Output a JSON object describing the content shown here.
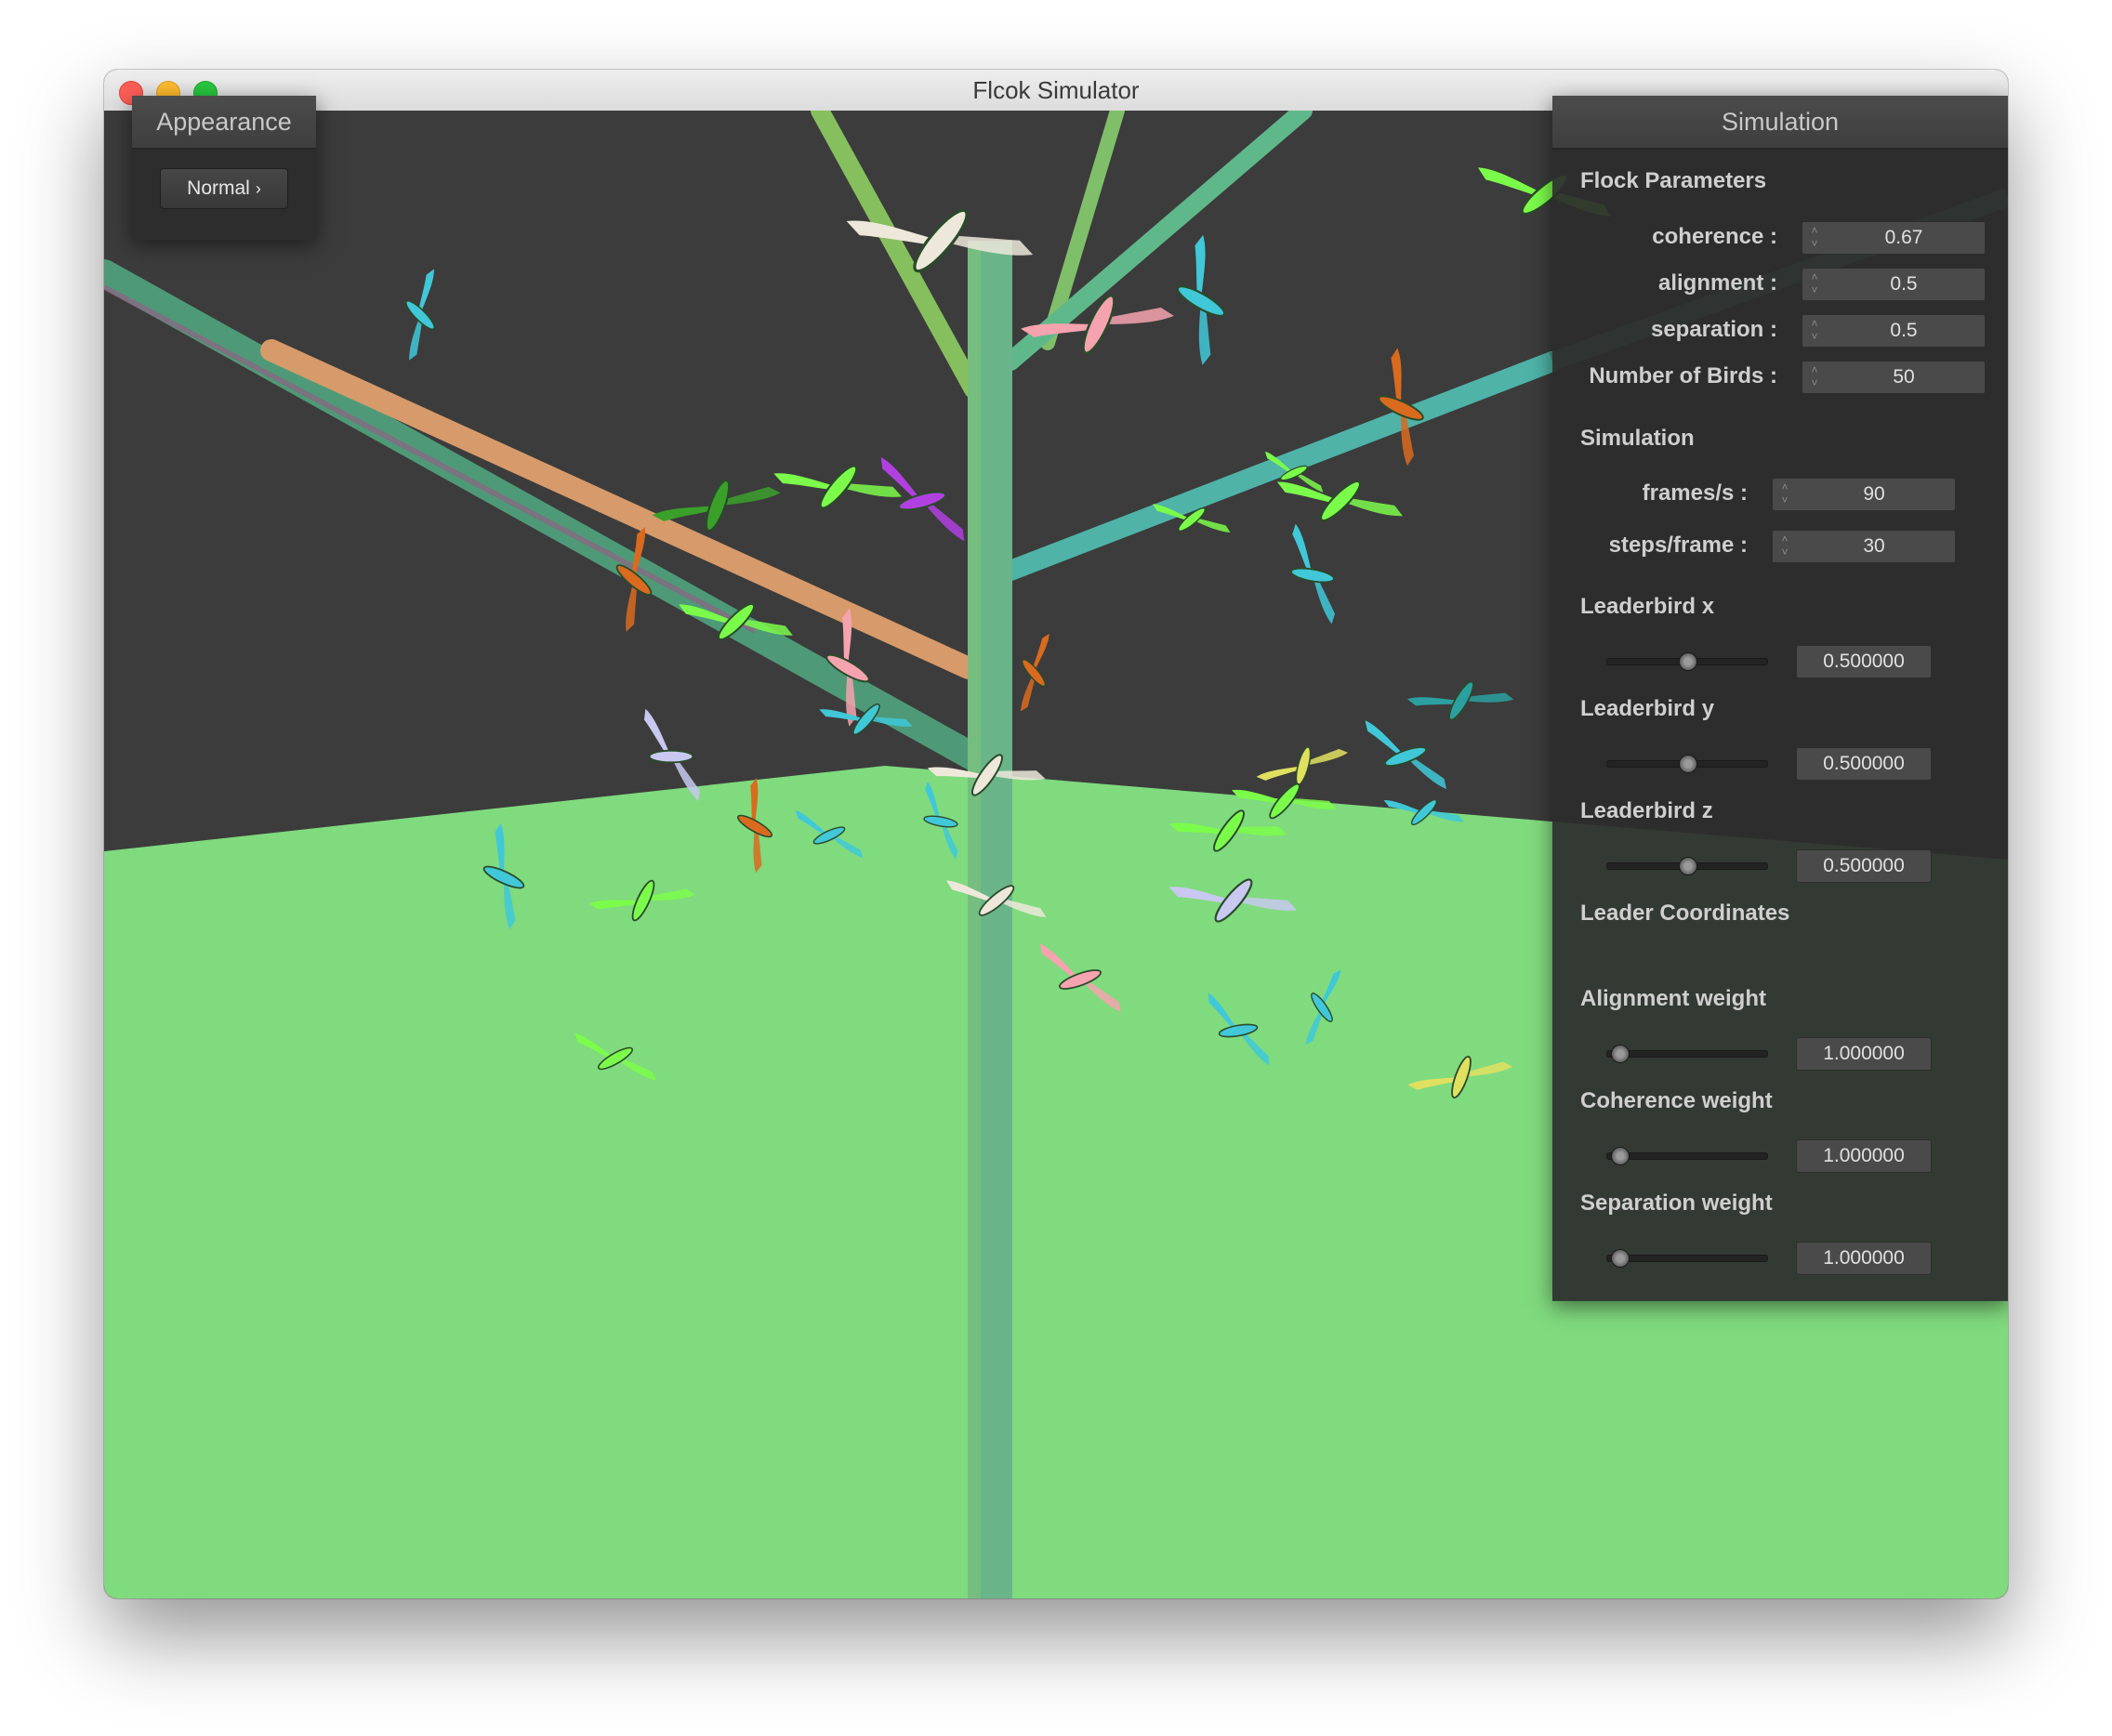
{
  "window": {
    "title": "Flcok Simulator"
  },
  "appearance": {
    "title": "Appearance",
    "mode_label": "Normal",
    "chevron": "›"
  },
  "simulation_panel": {
    "title": "Simulation",
    "flock_parameters": {
      "heading": "Flock Parameters",
      "coherence": {
        "label": "coherence :",
        "value": "0.67"
      },
      "alignment": {
        "label": "alignment :",
        "value": "0.5"
      },
      "separation": {
        "label": "separation :",
        "value": "0.5"
      },
      "num_birds": {
        "label": "Number of Birds :",
        "value": "50"
      }
    },
    "simulation": {
      "heading": "Simulation",
      "fps": {
        "label": "frames/s :",
        "value": "90"
      },
      "steps": {
        "label": "steps/frame :",
        "value": "30"
      }
    },
    "leader_x": {
      "label": "Leaderbird x",
      "value": "0.500000",
      "level": 0.5
    },
    "leader_y": {
      "label": "Leaderbird y",
      "value": "0.500000",
      "level": 0.5
    },
    "leader_z": {
      "label": "Leaderbird z",
      "value": "0.500000",
      "level": 0.5
    },
    "leader_coords": {
      "heading": "Leader Coordinates"
    },
    "alignment_weight": {
      "label": "Alignment weight",
      "value": "1.000000",
      "level": 0.0
    },
    "coherence_weight": {
      "label": "Coherence weight",
      "value": "1.000000",
      "level": 0.0
    },
    "separation_weight": {
      "label": "Separation weight",
      "value": "1.000000",
      "level": 0.0
    }
  },
  "scene": {
    "sky_color": "#3c3c3c",
    "ground_color": "#80da7e",
    "tree_colors": [
      "#7fbf6a",
      "#4fb3a8",
      "#d79a6a"
    ],
    "bird_colors": [
      "#7CFC4A",
      "#F5A3AE",
      "#EDE8DA",
      "#40C8D8",
      "#D96A1E",
      "#B040E0",
      "#3AA02A",
      "#C8C8F0",
      "#E0E060",
      "#2CA0A0"
    ]
  }
}
